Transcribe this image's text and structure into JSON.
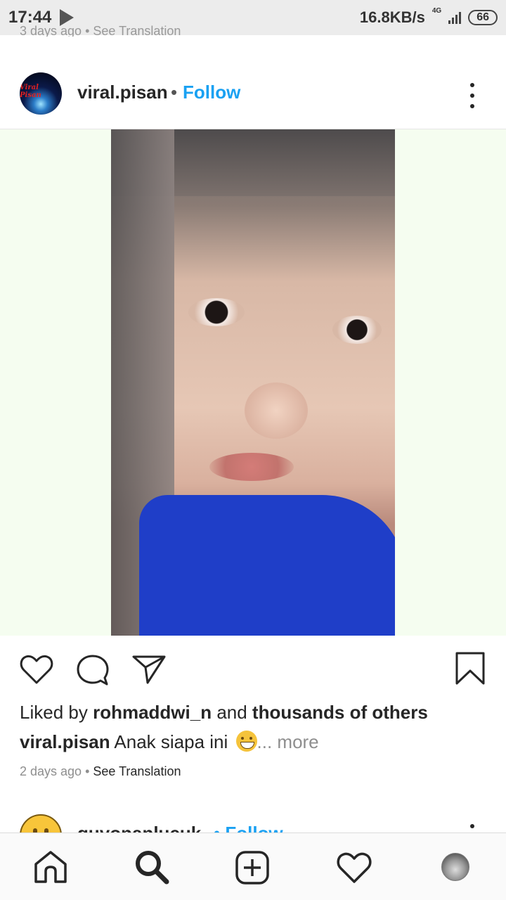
{
  "status_bar": {
    "time": "17:44",
    "speed": "16.8KB/s",
    "network": "4G",
    "battery": "66"
  },
  "previous_post": {
    "caption_fragment": "3 days ago • See Translation"
  },
  "post": {
    "username": "viral.pisan",
    "separator": "•",
    "follow_label": "Follow",
    "avatar_text": "Viral Pisan",
    "likes": {
      "prefix": "Liked by ",
      "user": "rohmaddwi_n",
      "middle": " and ",
      "others": "thousands of others"
    },
    "caption": {
      "username": "viral.pisan",
      "text": " Anak siapa ini ",
      "more": "... more"
    },
    "time_ago": "2 days ago",
    "meta_separator": " • ",
    "see_translation": "See Translation"
  },
  "next_post": {
    "username": "guyonanlucuk",
    "follow_label": "• Follow"
  },
  "icons": {
    "like": "heart-icon",
    "comment": "comment-icon",
    "share": "send-icon",
    "save": "bookmark-icon",
    "nav": [
      "home-icon",
      "search-icon",
      "add-icon",
      "activity-heart-icon",
      "profile-avatar"
    ]
  },
  "colors": {
    "follow": "#1aa1f2",
    "text": "#262626",
    "muted": "#8e8e8e",
    "media_bg": "#f5fdf0"
  }
}
